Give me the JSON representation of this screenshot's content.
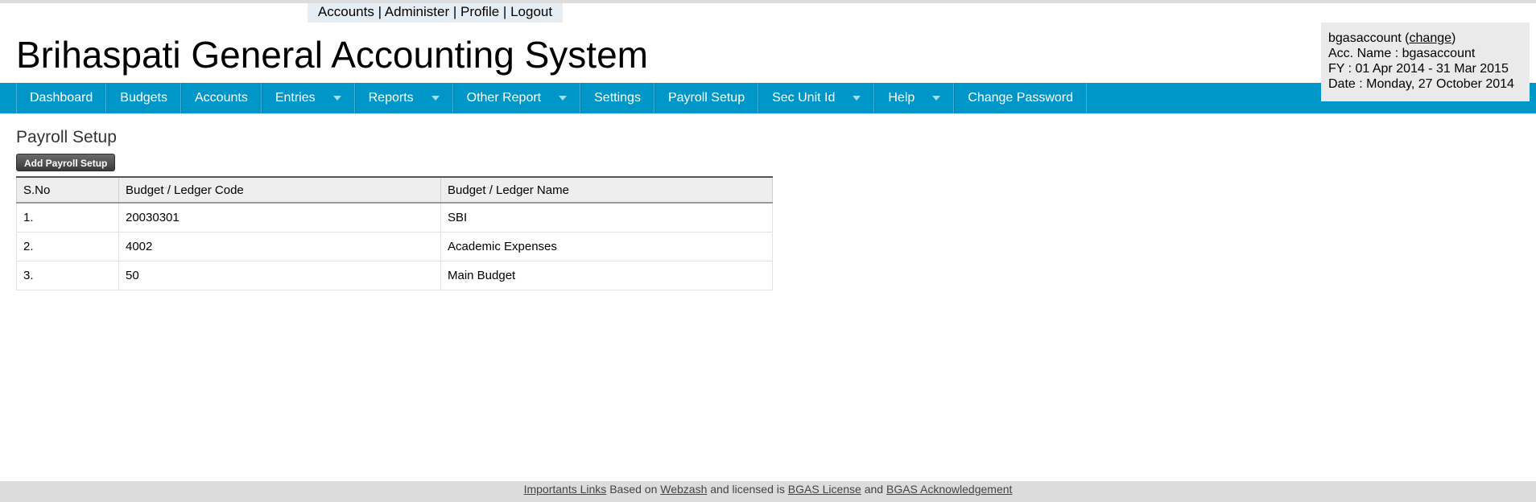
{
  "top_links": {
    "accounts": "Accounts",
    "administer": "Administer",
    "profile": "Profile",
    "logout": "Logout",
    "separator": "|"
  },
  "app_title": "Brihaspati General Accounting System",
  "account_box": {
    "username": "bgasaccount",
    "change_label": "change",
    "acc_name": "Acc. Name : bgasaccount",
    "fy": "FY : 01 Apr 2014 - 31 Mar 2015",
    "date": "Date : Monday, 27 October 2014"
  },
  "nav": {
    "items": [
      {
        "label": "Dashboard"
      },
      {
        "label": "Budgets"
      },
      {
        "label": "Accounts"
      },
      {
        "label": "Entries"
      },
      {
        "label": "Reports"
      },
      {
        "label": "Other Report"
      },
      {
        "label": "Settings"
      },
      {
        "label": "Payroll Setup"
      },
      {
        "label": "Sec Unit Id"
      },
      {
        "label": "Help"
      },
      {
        "label": "Change Password"
      }
    ]
  },
  "page": {
    "title": "Payroll Setup",
    "add_button": "Add Payroll Setup"
  },
  "table": {
    "headers": [
      "S.No",
      "Budget / Ledger Code",
      "Budget / Ledger Name"
    ],
    "rows": [
      [
        "1.",
        "20030301",
        "SBI"
      ],
      [
        "2.",
        "4002",
        "Academic Expenses"
      ],
      [
        "3.",
        "50",
        "Main Budget"
      ]
    ]
  },
  "footer": {
    "important_links": "Importants Links",
    "based_on": "Based on",
    "webzash": "Webzash",
    "licensed_is": "and licensed is",
    "bgas_license": "BGAS License",
    "and": "and",
    "bgas_ack": "BGAS Acknowledgement"
  }
}
